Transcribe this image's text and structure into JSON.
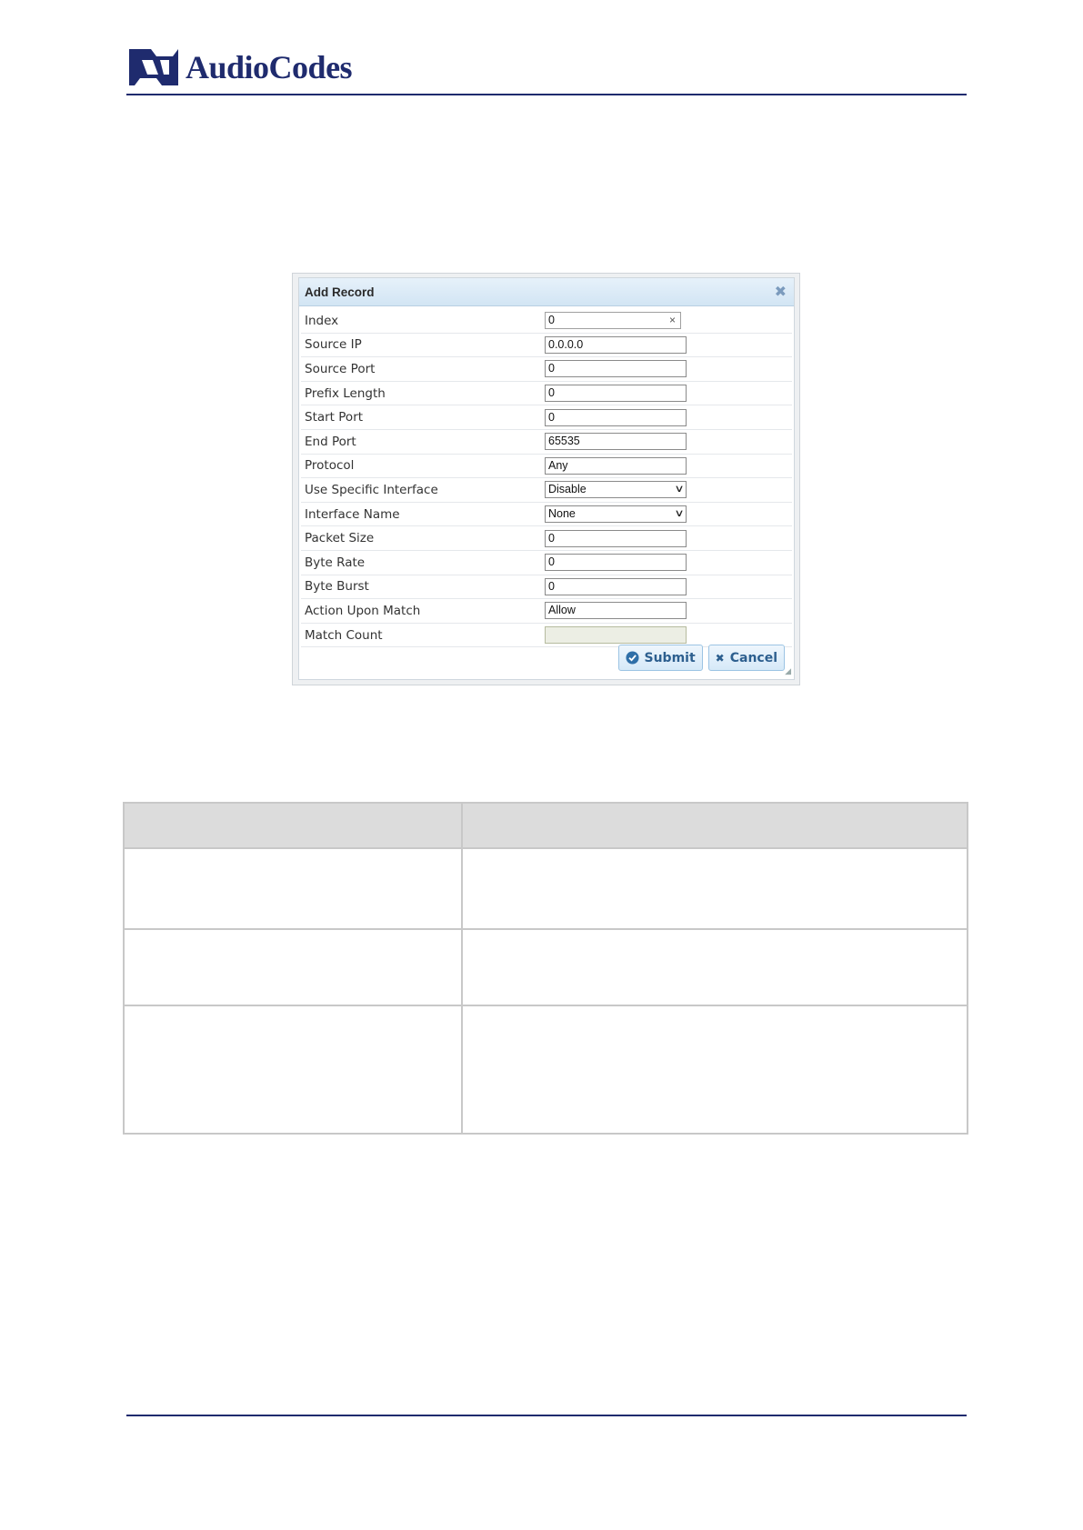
{
  "header": {
    "brand": "AudioCodes",
    "brand_color": "#1f2b6e"
  },
  "dialog": {
    "title": "Add Record",
    "close_icon": "close-icon",
    "fields": [
      {
        "label": "Index",
        "value": "0",
        "type": "text-clearable"
      },
      {
        "label": "Source IP",
        "value": "0.0.0.0",
        "type": "text"
      },
      {
        "label": "Source Port",
        "value": "0",
        "type": "text"
      },
      {
        "label": "Prefix Length",
        "value": "0",
        "type": "text"
      },
      {
        "label": "Start Port",
        "value": "0",
        "type": "text"
      },
      {
        "label": "End Port",
        "value": "65535",
        "type": "text"
      },
      {
        "label": "Protocol",
        "value": "Any",
        "type": "text"
      },
      {
        "label": "Use Specific Interface",
        "value": "Disable",
        "type": "select"
      },
      {
        "label": "Interface Name",
        "value": "None",
        "type": "select"
      },
      {
        "label": "Packet Size",
        "value": "0",
        "type": "text"
      },
      {
        "label": "Byte Rate",
        "value": "0",
        "type": "text"
      },
      {
        "label": "Byte Burst",
        "value": "0",
        "type": "text"
      },
      {
        "label": "Action Upon Match",
        "value": "Allow",
        "type": "text"
      },
      {
        "label": "Match Count",
        "value": "",
        "type": "disabled"
      }
    ],
    "submit_label": "Submit",
    "cancel_label": "Cancel"
  },
  "table": {
    "header": [
      "",
      ""
    ],
    "rows": [
      [
        "",
        ""
      ],
      [
        "",
        ""
      ],
      [
        "",
        ""
      ]
    ]
  }
}
